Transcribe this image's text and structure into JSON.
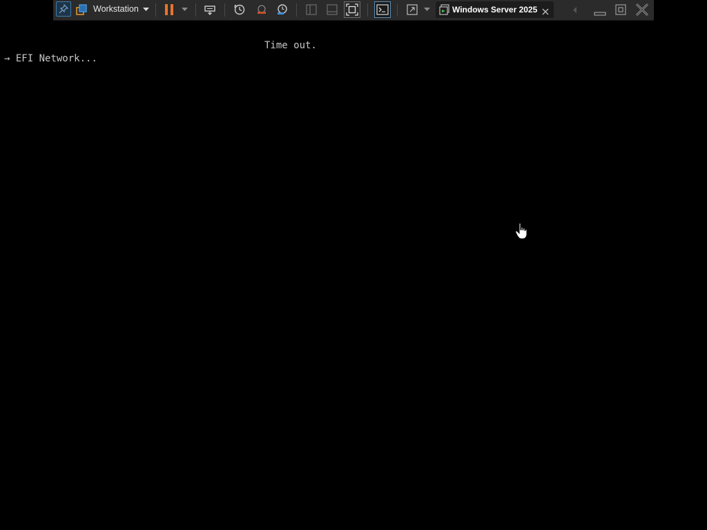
{
  "toolbar": {
    "library_menu_label": "Workstation",
    "tab_title": "Windows Server 2025"
  },
  "console": {
    "timeout_text": "Time out.",
    "boot_entry_arrow": "→",
    "boot_entry_text": "EFI Network..."
  },
  "colors": {
    "toolbar_bg": "#2b2b2b",
    "pause_accent": "#e8742c",
    "console_bg": "#000000",
    "console_text": "#c8c8c8"
  },
  "icons": [
    "pin-icon",
    "library-icon",
    "dropdown-arrow-icon",
    "pause-icon",
    "send-keys-icon",
    "snapshot-icon",
    "revert-snapshot-icon",
    "snapshot-manager-icon",
    "console-view-icon",
    "thumbnail-bar-icon",
    "fit-guest-icon",
    "terminal-icon",
    "fullscreen-icon",
    "vm-tab-icon",
    "close-tab-icon",
    "scroll-left-icon",
    "minimize-icon",
    "restore-icon",
    "close-window-icon",
    "hand-cursor-icon"
  ]
}
